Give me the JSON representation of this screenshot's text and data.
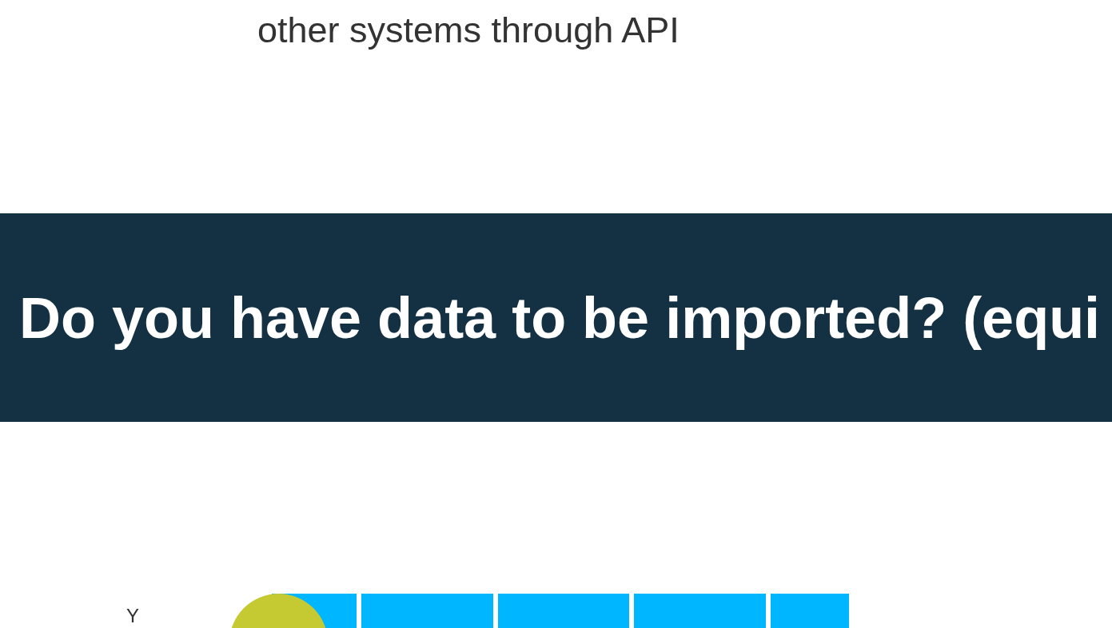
{
  "intro_text": "other systems through API",
  "question_banner": {
    "title": "Do you have data to be imported? (equi"
  },
  "answer_row": {
    "label": "Y"
  }
}
